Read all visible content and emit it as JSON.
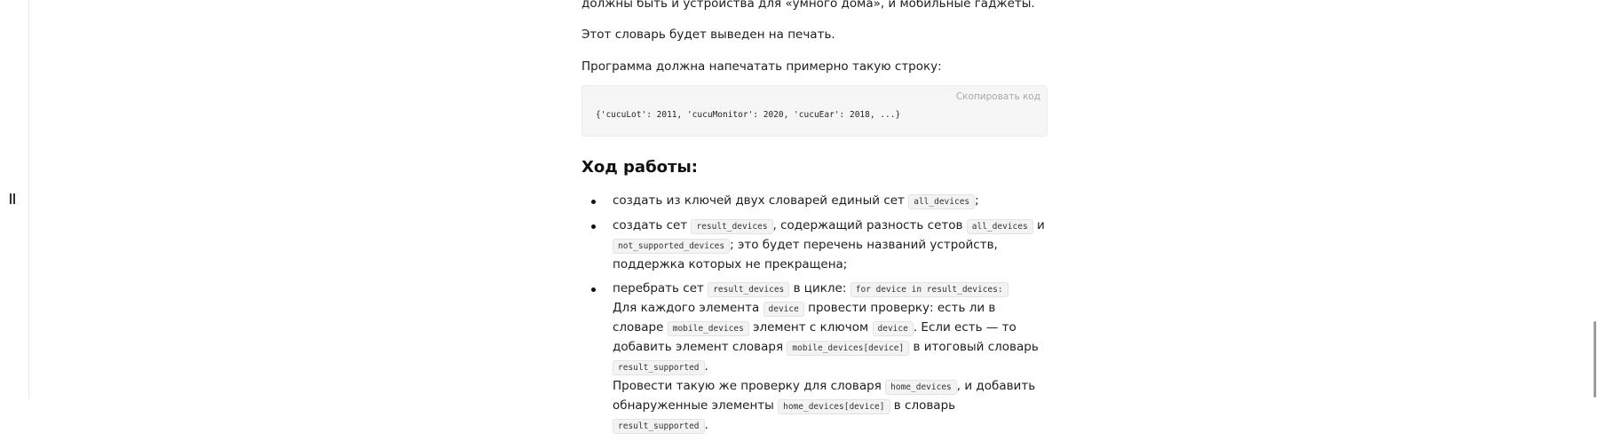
{
  "intro": {
    "cut_line": "должны быть и устройства для «умного дома», и мобильные гаджеты.",
    "print_line": "Этот словарь будет выведен на печать.",
    "program_line": "Программа должна напечатать примерно такую строку:"
  },
  "code_block": {
    "copy_label": "Скопировать код",
    "code": "{'cucuLot': 2011, 'cucuMonitor': 2020, 'cucuEar': 2018, ...}"
  },
  "section": {
    "title": "Ход работы:"
  },
  "steps": [
    {
      "t1": "создать из ключей двух словарей единый сет",
      "c1": "all_devices",
      "t2": ";"
    },
    {
      "t1": "создать сет",
      "c1": "result_devices",
      "t2": ", содержащий разность сетов",
      "c2": "all_devices",
      "t3": "и",
      "c3": "not_supported_devices",
      "t4": "; это будет перечень названий устройств, поддержка которых не прекращена;"
    },
    {
      "t1": "перебрать сет",
      "c1": "result_devices",
      "t2": "в цикле:",
      "c2": "for device in result_devices:",
      "t3": "Для каждого элемента",
      "c3": "device",
      "t4": "провести проверку: есть ли в словаре",
      "c4": "mobile_devices",
      "t5": "элемент с ключом",
      "c5": "device",
      "t6": ". Если есть — то добавить элемент словаря",
      "c6": "mobile_devices[device]",
      "t7": "в итоговый словарь",
      "c7": "result_supported",
      "t8": ".",
      "t9": "Провести такую же проверку для словаря",
      "c9": "home_devices",
      "t10": ", и добавить обнаруженные элементы",
      "c10": "home_devices[device]",
      "t11": "в словарь",
      "c11": "result_supported",
      "t12": "."
    }
  ]
}
